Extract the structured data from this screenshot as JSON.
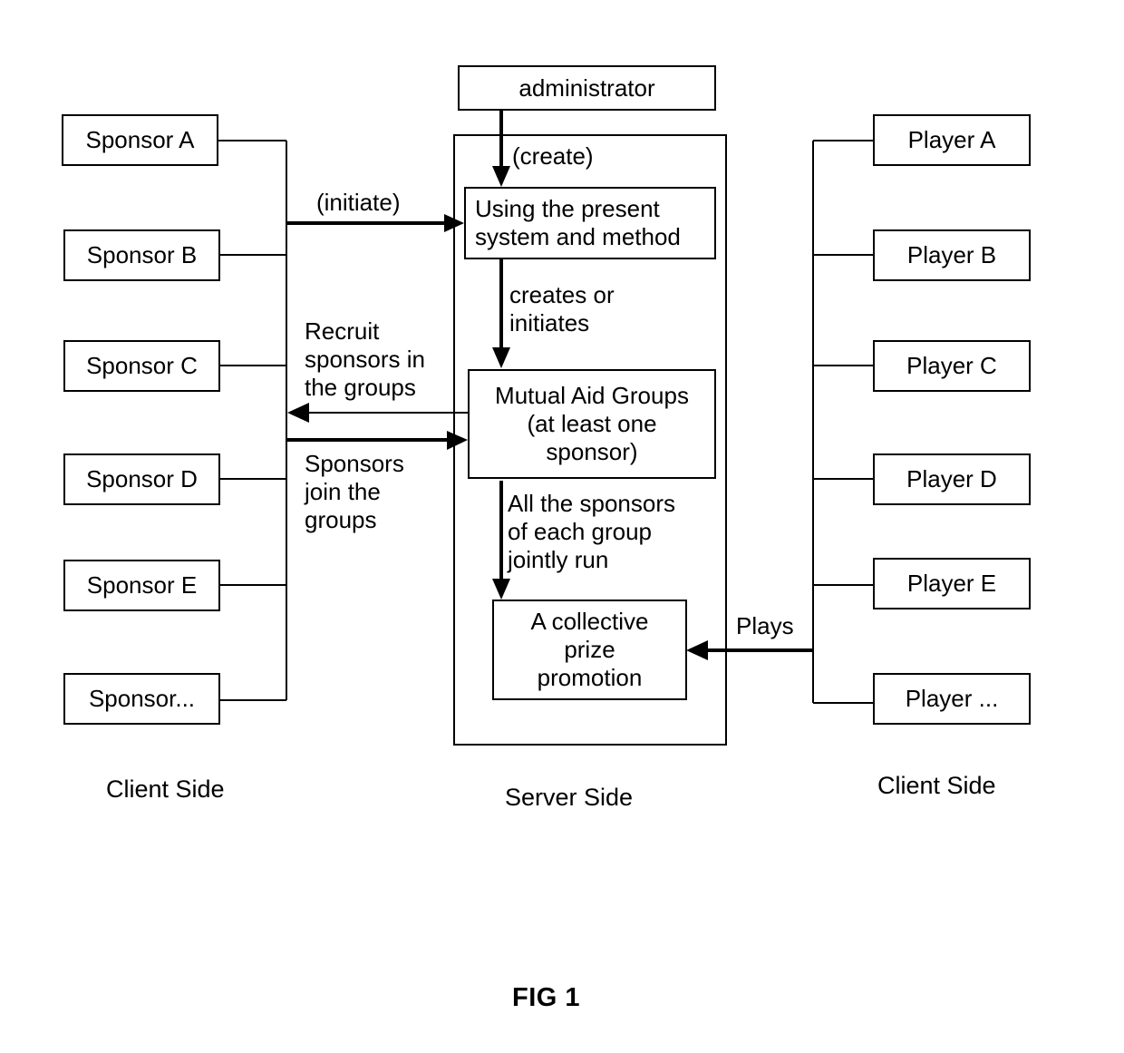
{
  "figure": {
    "caption": "FIG 1"
  },
  "sides": {
    "left_label": "Client Side",
    "center_label": "Server Side",
    "right_label": "Client Side"
  },
  "sponsors": {
    "items": [
      {
        "label": "Sponsor A"
      },
      {
        "label": "Sponsor B"
      },
      {
        "label": "Sponsor C"
      },
      {
        "label": "Sponsor D"
      },
      {
        "label": "Sponsor E"
      },
      {
        "label": "Sponsor..."
      }
    ]
  },
  "players": {
    "items": [
      {
        "label": "Player A"
      },
      {
        "label": "Player B"
      },
      {
        "label": "Player C"
      },
      {
        "label": "Player D"
      },
      {
        "label": "Player E"
      },
      {
        "label": "Player ..."
      }
    ]
  },
  "server": {
    "administrator": "administrator",
    "process_box": "Using the present\nsystem and method",
    "groups_box": "Mutual Aid Groups\n(at least one\nsponsor)",
    "promotion_box": "A collective\nprize\npromotion"
  },
  "edges": {
    "create": "(create)",
    "initiate": "(initiate)",
    "creates_or_initiates": "creates or\ninitiates",
    "recruit_sponsors": "Recruit\nsponsors in\nthe groups",
    "sponsors_join": "Sponsors\njoin the\ngroups",
    "jointly_run": "All the sponsors\nof each group\njointly run",
    "plays": "Plays"
  }
}
